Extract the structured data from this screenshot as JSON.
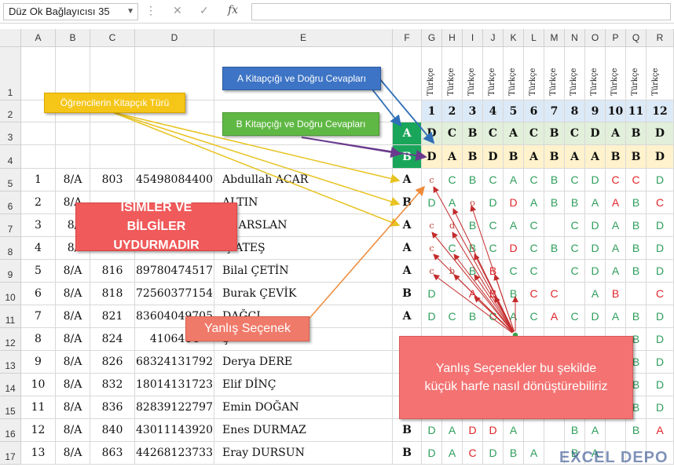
{
  "namebox": "Düz Ok Bağlayıcısı 35",
  "columns": [
    "A",
    "B",
    "C",
    "D",
    "E",
    "F",
    "G",
    "H",
    "I",
    "J",
    "K",
    "L",
    "M",
    "N",
    "O",
    "P",
    "Q",
    "R"
  ],
  "question_header": "Türkçe",
  "question_numbers": [
    "1",
    "2",
    "3",
    "4",
    "5",
    "6",
    "7",
    "8",
    "9",
    "10",
    "11",
    "12"
  ],
  "key_a": {
    "label": "A",
    "answers": [
      "D",
      "C",
      "B",
      "C",
      "A",
      "C",
      "B",
      "C",
      "D",
      "A",
      "B",
      "D"
    ]
  },
  "key_b": {
    "label": "B",
    "answers": [
      "D",
      "A",
      "B",
      "D",
      "B",
      "A",
      "B",
      "A",
      "A",
      "B",
      "B",
      "D"
    ]
  },
  "students": [
    {
      "row": "5",
      "no": "1",
      "cls": "8/A",
      "num": "803",
      "id": "45498084400",
      "name": "Abdullah ACAR",
      "type": "A",
      "answers": [
        [
          "c",
          "w"
        ],
        [
          "C",
          "g"
        ],
        [
          "B",
          "g"
        ],
        [
          "C",
          "g"
        ],
        [
          "A",
          "g"
        ],
        [
          "C",
          "g"
        ],
        [
          "B",
          "g"
        ],
        [
          "C",
          "g"
        ],
        [
          "D",
          "g"
        ],
        [
          "C",
          "r"
        ],
        [
          "C",
          "r"
        ],
        [
          "D",
          "g"
        ]
      ]
    },
    {
      "row": "6",
      "no": "2",
      "cls": "8/A",
      "num": "",
      "id": "",
      "name": "ALTIN",
      "type": "B",
      "answers": [
        [
          "D",
          "g"
        ],
        [
          "A",
          "g"
        ],
        [
          "o",
          "w"
        ],
        [
          "D",
          "g"
        ],
        [
          "D",
          "r"
        ],
        [
          "A",
          "g"
        ],
        [
          "B",
          "g"
        ],
        [
          "B",
          "g"
        ],
        [
          "A",
          "g"
        ],
        [
          "A",
          "r"
        ],
        [
          "B",
          "g"
        ],
        [
          "C",
          "r"
        ]
      ]
    },
    {
      "row": "7",
      "no": "3",
      "cls": "8/",
      "num": "",
      "id": "",
      "name": "ye ARSLAN",
      "type": "A",
      "answers": [
        [
          "c",
          "w"
        ],
        [
          "d",
          "w"
        ],
        [
          "B",
          "g"
        ],
        [
          "C",
          "g"
        ],
        [
          "A",
          "g"
        ],
        [
          "C",
          "g"
        ],
        [
          "",
          "g"
        ],
        [
          "C",
          "g"
        ],
        [
          "D",
          "g"
        ],
        [
          "A",
          "g"
        ],
        [
          "B",
          "g"
        ],
        [
          "D",
          "g"
        ]
      ]
    },
    {
      "row": "8",
      "no": "4",
      "cls": "8/",
      "num": "",
      "id": "",
      "name": "ış ATEŞ",
      "type": "A",
      "answers": [
        [
          "c",
          "w"
        ],
        [
          "C",
          "g"
        ],
        [
          "B",
          "g"
        ],
        [
          "C",
          "g"
        ],
        [
          "D",
          "r"
        ],
        [
          "C",
          "g"
        ],
        [
          "B",
          "g"
        ],
        [
          "C",
          "g"
        ],
        [
          "D",
          "g"
        ],
        [
          "A",
          "g"
        ],
        [
          "B",
          "g"
        ],
        [
          "D",
          "g"
        ]
      ]
    },
    {
      "row": "9",
      "no": "5",
      "cls": "8/A",
      "num": "816",
      "id": "89780474517",
      "name": "Bilal ÇETİN",
      "type": "A",
      "answers": [
        [
          "c",
          "w"
        ],
        [
          "b",
          "w"
        ],
        [
          "B",
          "g"
        ],
        [
          "B",
          "r"
        ],
        [
          "C",
          "g"
        ],
        [
          "C",
          "g"
        ],
        [
          "",
          "g"
        ],
        [
          "C",
          "g"
        ],
        [
          "D",
          "g"
        ],
        [
          "A",
          "g"
        ],
        [
          "B",
          "g"
        ],
        [
          "D",
          "g"
        ]
      ]
    },
    {
      "row": "10",
      "no": "6",
      "cls": "8/A",
      "num": "818",
      "id": "72560377154",
      "name": "Burak ÇEVİK",
      "type": "B",
      "answers": [
        [
          "D",
          "g"
        ],
        [
          "",
          "g"
        ],
        [
          "A",
          "r"
        ],
        [
          "B",
          "r"
        ],
        [
          "B",
          "g"
        ],
        [
          "C",
          "r"
        ],
        [
          "C",
          "r"
        ],
        [
          "",
          "g"
        ],
        [
          "A",
          "g"
        ],
        [
          "B",
          "r"
        ],
        [
          "",
          "g"
        ],
        [
          "C",
          "r"
        ]
      ]
    },
    {
      "row": "11",
      "no": "7",
      "cls": "8/A",
      "num": "821",
      "id": "83604049705",
      "name": "DAĞCI",
      "type": "A",
      "answers": [
        [
          "D",
          "g"
        ],
        [
          "C",
          "g"
        ],
        [
          "B",
          "g"
        ],
        [
          "C",
          "g"
        ],
        [
          "A",
          "g"
        ],
        [
          "C",
          "g"
        ],
        [
          "A",
          "r"
        ],
        [
          "C",
          "g"
        ],
        [
          "D",
          "g"
        ],
        [
          "A",
          "g"
        ],
        [
          "B",
          "g"
        ],
        [
          "D",
          "g"
        ]
      ]
    },
    {
      "row": "12",
      "no": "8",
      "cls": "8/A",
      "num": "824",
      "id": "4106414",
      "name": "Ş",
      "type": "",
      "answers": [
        [
          "",
          "g"
        ],
        [
          "",
          "g"
        ],
        [
          "",
          "g"
        ],
        [
          "",
          "g"
        ],
        [
          "",
          "g"
        ],
        [
          "",
          "g"
        ],
        [
          "",
          "g"
        ],
        [
          "",
          "g"
        ],
        [
          "",
          "g"
        ],
        [
          "",
          "g"
        ],
        [
          "B",
          "g"
        ],
        [
          "D",
          "g"
        ]
      ]
    },
    {
      "row": "13",
      "no": "9",
      "cls": "8/A",
      "num": "826",
      "id": "68324131792",
      "name": "Derya DERE",
      "type": "",
      "answers": [
        [
          "",
          "g"
        ],
        [
          "",
          "g"
        ],
        [
          "",
          "g"
        ],
        [
          "",
          "g"
        ],
        [
          "",
          "g"
        ],
        [
          "",
          "g"
        ],
        [
          "",
          "g"
        ],
        [
          "",
          "g"
        ],
        [
          "",
          "g"
        ],
        [
          "",
          "g"
        ],
        [
          "B",
          "g"
        ],
        [
          "D",
          "g"
        ]
      ]
    },
    {
      "row": "14",
      "no": "10",
      "cls": "8/A",
      "num": "832",
      "id": "18014131723",
      "name": "Elif DİNÇ",
      "type": "",
      "answers": [
        [
          "",
          "g"
        ],
        [
          "",
          "g"
        ],
        [
          "",
          "g"
        ],
        [
          "",
          "g"
        ],
        [
          "",
          "g"
        ],
        [
          "",
          "g"
        ],
        [
          "",
          "g"
        ],
        [
          "",
          "g"
        ],
        [
          "",
          "g"
        ],
        [
          "",
          "g"
        ],
        [
          "B",
          "g"
        ],
        [
          "D",
          "g"
        ]
      ]
    },
    {
      "row": "15",
      "no": "11",
      "cls": "8/A",
      "num": "836",
      "id": "82839122797",
      "name": "Emin DOĞAN",
      "type": "",
      "answers": [
        [
          "",
          "g"
        ],
        [
          "",
          "g"
        ],
        [
          "",
          "g"
        ],
        [
          "",
          "g"
        ],
        [
          "",
          "g"
        ],
        [
          "",
          "g"
        ],
        [
          "",
          "g"
        ],
        [
          "",
          "g"
        ],
        [
          "",
          "g"
        ],
        [
          "",
          "g"
        ],
        [
          "B",
          "g"
        ],
        [
          "D",
          "g"
        ]
      ]
    },
    {
      "row": "16",
      "no": "12",
      "cls": "8/A",
      "num": "840",
      "id": "43011143920",
      "name": "Enes DURMAZ",
      "type": "B",
      "answers": [
        [
          "D",
          "g"
        ],
        [
          "A",
          "g"
        ],
        [
          "D",
          "r"
        ],
        [
          "D",
          "r"
        ],
        [
          "A",
          "g"
        ],
        [
          "",
          "g"
        ],
        [
          "",
          "g"
        ],
        [
          "B",
          "g"
        ],
        [
          "A",
          "g"
        ],
        [
          "",
          "g"
        ],
        [
          "B",
          "g"
        ],
        [
          "A",
          "r"
        ]
      ]
    },
    {
      "row": "17",
      "no": "13",
      "cls": "8/A",
      "num": "863",
      "id": "44268123733",
      "name": "Eray DURSUN",
      "type": "B",
      "answers": [
        [
          "D",
          "g"
        ],
        [
          "A",
          "g"
        ],
        [
          "C",
          "r"
        ],
        [
          "D",
          "g"
        ],
        [
          "B",
          "g"
        ],
        [
          "A",
          "g"
        ],
        [
          "",
          "g"
        ],
        [
          "B",
          "g"
        ],
        [
          "A",
          "g"
        ],
        [
          "",
          "g"
        ],
        [
          "",
          "g"
        ],
        [
          "",
          "g"
        ]
      ]
    }
  ],
  "row_labels": [
    "1",
    "2",
    "3",
    "4"
  ],
  "callouts": {
    "kitapcik_turu": "Öğrencilerin Kitapçık Türü",
    "a_kitapcik": "A Kitapçığı ve Doğru Cevapları",
    "b_kitapcik": "B Kitapçığı ve Doğru Cevapları",
    "isimler": "İSİMLER VE BİLGİLER UYDURMADIR",
    "yanlis": "Yanlış Seçenek",
    "soru": "Yanlış Seçenekler bu şekilde küçük harfe nasıl dönüştürebiliriz"
  },
  "watermark": "EXCEL DEPO",
  "colors": {
    "correct": "#2f9e5c",
    "wrong": "#e0262a",
    "key_green": "#1aa65a",
    "q_blue": "#dce9f6",
    "key_a_bg": "#e2efda",
    "key_b_bg": "#fff2cc"
  }
}
